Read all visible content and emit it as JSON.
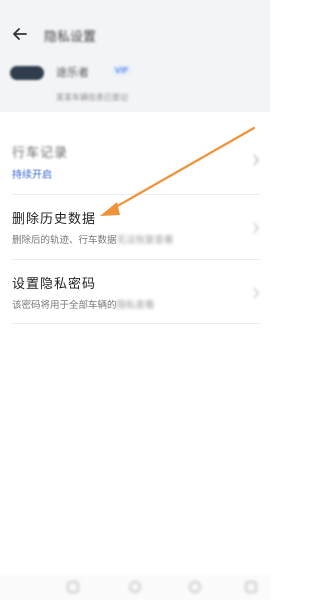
{
  "header": {
    "title": "隐私设置",
    "vehicle_name": "途乐者",
    "vehicle_badge": "VIP",
    "vehicle_sub": "某某车辆信息已登记"
  },
  "settings": {
    "driving_record": {
      "title": "行车记录",
      "status": "持续开启"
    },
    "delete_history": {
      "title": "删除历史数据",
      "desc_visible": "删除后的轨迹、行车数据",
      "desc_blurred": "无法恢复查看"
    },
    "privacy_password": {
      "title": "设置隐私密码",
      "desc_visible": "该密码将用于全部车辆的",
      "desc_blurred": "隐私查看"
    }
  },
  "annotation": {
    "arrow_color": "#F0923A"
  },
  "icons": {
    "back": "arrow-left-icon",
    "chevron": "chevron-right-icon"
  },
  "colors": {
    "header_bg": "#f3f4f6",
    "accent_blue": "#3a6ccf",
    "text_primary": "#222222",
    "text_secondary": "#777777"
  }
}
